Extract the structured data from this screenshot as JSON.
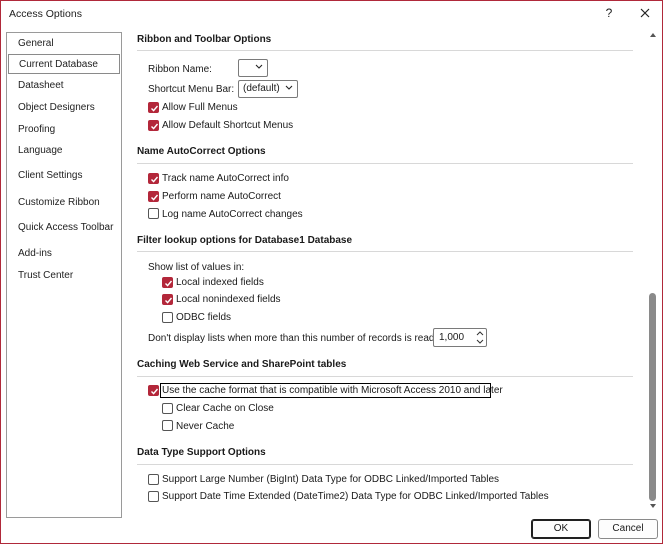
{
  "window": {
    "title": "Access Options",
    "help": "?"
  },
  "sidebar": {
    "items": [
      {
        "label": "General"
      },
      {
        "label": "Current Database"
      },
      {
        "label": "Datasheet"
      },
      {
        "label": "Object Designers"
      },
      {
        "label": "Proofing"
      },
      {
        "label": "Language"
      },
      {
        "label": "Client Settings"
      },
      {
        "label": "Customize Ribbon"
      },
      {
        "label": "Quick Access Toolbar"
      },
      {
        "label": "Add-ins"
      },
      {
        "label": "Trust Center"
      }
    ],
    "selected": "Current Database"
  },
  "ribbon": {
    "title": "Ribbon and Toolbar Options",
    "ribbon_name_label": "Ribbon Name:",
    "ribbon_name_value": "",
    "shortcut_label": "Shortcut Menu Bar:",
    "shortcut_value": "(default)",
    "allow_full_menus": {
      "label": "Allow Full Menus",
      "checked": true
    },
    "allow_default_shortcut": {
      "label": "Allow Default Shortcut Menus",
      "checked": true
    }
  },
  "autocorrect": {
    "title": "Name AutoCorrect Options",
    "track": {
      "label": "Track name AutoCorrect info",
      "checked": true
    },
    "perform": {
      "label": "Perform name AutoCorrect",
      "checked": true
    },
    "log": {
      "label": "Log name AutoCorrect changes",
      "checked": false
    }
  },
  "filter": {
    "title": "Filter lookup options for Database1 Database",
    "show_list_label": "Show list of values in:",
    "local_indexed": {
      "label": "Local indexed fields",
      "checked": true
    },
    "local_nonindexed": {
      "label": "Local nonindexed fields",
      "checked": true
    },
    "odbc": {
      "label": "ODBC fields",
      "checked": false
    },
    "limit_label": "Don't display lists when more than this number of records is read:",
    "limit_value": "1,000"
  },
  "caching": {
    "title": "Caching Web Service and SharePoint tables",
    "use_cache": {
      "label": "Use the cache format that is compatible with Microsoft Access 2010 and later",
      "checked": true
    },
    "clear_cache": {
      "label": "Clear Cache on Close",
      "checked": false
    },
    "never_cache": {
      "label": "Never Cache",
      "checked": false
    }
  },
  "datatype": {
    "title": "Data Type Support Options",
    "bigint": {
      "label": "Support Large Number (BigInt) Data Type for ODBC Linked/Imported Tables",
      "checked": false
    },
    "datetime2": {
      "label": "Support Date Time Extended (DateTime2) Data Type for ODBC Linked/Imported Tables",
      "checked": false
    }
  },
  "buttons": {
    "ok": "OK",
    "cancel": "Cancel"
  },
  "colors": {
    "accent": "#b3273a",
    "border": "#b0293a"
  },
  "icons": {
    "close": "close-icon",
    "help": "help-icon",
    "checkmark": "checkmark-icon",
    "chevron": "chevron-down-icon"
  }
}
